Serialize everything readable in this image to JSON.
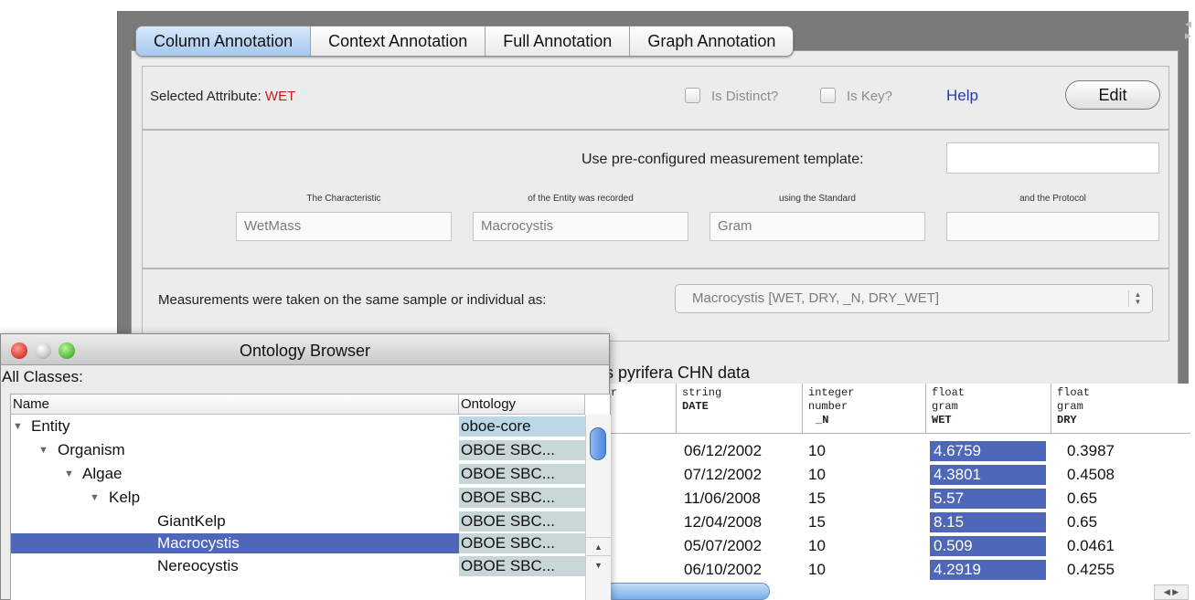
{
  "tabs": [
    {
      "label": "Column Annotation",
      "active": true
    },
    {
      "label": "Context Annotation",
      "active": false
    },
    {
      "label": "Full Annotation",
      "active": false
    },
    {
      "label": "Graph Annotation",
      "active": false
    }
  ],
  "attribute": {
    "label": "Selected Attribute:",
    "value": "WET",
    "is_distinct_label": "Is Distinct?",
    "is_key_label": "Is Key?",
    "help_label": "Help",
    "edit_label": "Edit"
  },
  "measurement": {
    "template_label": "Use pre-configured measurement template:",
    "template_value": "",
    "columns": [
      {
        "label": "The Characteristic",
        "value": "WetMass"
      },
      {
        "label": "of the Entity was recorded",
        "value": "Macrocystis"
      },
      {
        "label": "using the Standard",
        "value": "Gram"
      },
      {
        "label": "and the Protocol",
        "value": ""
      }
    ]
  },
  "sample": {
    "label": "Measurements were taken on the same sample or individual as:",
    "selected": "Macrocystis [WET, DRY, _N, DRY_WET]"
  },
  "dataset": {
    "title": "s pyrifera CHN data",
    "columns": [
      {
        "type": "r",
        "unit": "",
        "name": ""
      },
      {
        "type": "string",
        "unit": "",
        "name": "DATE"
      },
      {
        "type": "integer",
        "unit": "number",
        "name": "_N"
      },
      {
        "type": "float",
        "unit": "gram",
        "name": "WET"
      },
      {
        "type": "float",
        "unit": "gram",
        "name": "DRY"
      }
    ],
    "rows": [
      [
        "06/12/2002",
        "10",
        "4.6759",
        "0.3987"
      ],
      [
        "07/12/2002",
        "10",
        "4.3801",
        "0.4508"
      ],
      [
        "11/06/2008",
        "15",
        "5.57",
        "0.65"
      ],
      [
        "12/04/2008",
        "15",
        "8.15",
        "0.65"
      ],
      [
        "05/07/2002",
        "10",
        "0.509",
        "0.0461"
      ],
      [
        "06/10/2002",
        "10",
        "4.2919",
        "0.4255"
      ]
    ],
    "selected_column": "WET"
  },
  "ontology_browser": {
    "title": "Ontology Browser",
    "all_classes_label": "All Classes:",
    "headers": {
      "name": "Name",
      "ontology": "Ontology"
    },
    "rows": [
      {
        "name": "Entity",
        "ontology": "oboe-core",
        "expanded": true,
        "depth": 0,
        "selected": false
      },
      {
        "name": "Organism",
        "ontology": "OBOE SBC...",
        "expanded": true,
        "depth": 1,
        "selected": false
      },
      {
        "name": "Algae",
        "ontology": "OBOE SBC...",
        "expanded": true,
        "depth": 2,
        "selected": false
      },
      {
        "name": "Kelp",
        "ontology": "OBOE SBC...",
        "expanded": true,
        "depth": 3,
        "selected": false
      },
      {
        "name": "GiantKelp",
        "ontology": "OBOE SBC...",
        "expanded": null,
        "depth": 4,
        "selected": false
      },
      {
        "name": "Macrocystis",
        "ontology": "OBOE SBC...",
        "expanded": null,
        "depth": 4,
        "selected": true
      },
      {
        "name": "Nereocystis",
        "ontology": "OBOE SBC...",
        "expanded": null,
        "depth": 4,
        "selected": false
      }
    ]
  },
  "icons": {
    "expanded_arrow": "▼",
    "select_arrows": "▲▼",
    "scroll_up": "▲",
    "scroll_down": "▼",
    "scroll_left": "◀",
    "scroll_right": "▶"
  },
  "colors": {
    "selection": "#4f67b8",
    "attribute_value": "#cc1b1b",
    "help_link": "#2b39a8",
    "active_tab": "#a6c8ef",
    "close_button": "#e0443a",
    "minimize_button": "#c8c8c8",
    "zoom_button": "#5cc13e"
  }
}
